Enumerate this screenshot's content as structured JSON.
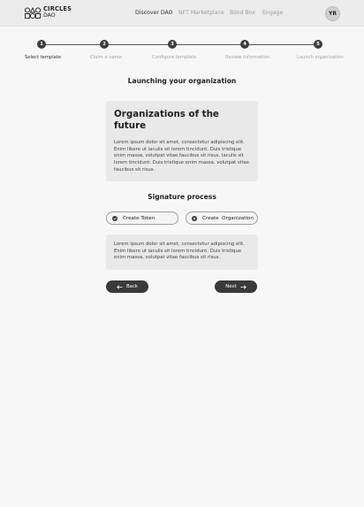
{
  "brand": {
    "line1": "CIRCLES",
    "line2": "DAO"
  },
  "nav": [
    "Discover DAO",
    "NFT Marketplace",
    "Blind Box",
    "Engage"
  ],
  "user": {
    "initials": "YR"
  },
  "steps": [
    {
      "number": "1",
      "label": "Select template",
      "active": true
    },
    {
      "number": "2",
      "label": "Claim a name",
      "active": false
    },
    {
      "number": "3",
      "label": "Configure template",
      "active": false
    },
    {
      "number": "4",
      "label": "Review information",
      "active": false
    },
    {
      "number": "5",
      "label": "Launch organization",
      "active": false
    }
  ],
  "launch": {
    "heading": "Launching your organization",
    "card_title": "Organizations of the future",
    "card_body": "Lorem ipsum dolor sit amet, consectetur adipiscing elit. Enim libero ut iaculis sit lorem tincidunt. Duis tristique enim massa, volutpat vitae faucibus sit risus. Iaculis sit lorem tincidunt. Duis tristique enim massa, volutpat vitae faucibus sit risus."
  },
  "signature": {
    "heading": "Signature process",
    "options": [
      {
        "label": "Create Token",
        "icon": "check-circle-icon"
      },
      {
        "label": "Create  Organization",
        "icon": "x-circle-icon"
      }
    ],
    "card_body": "Lorem ipsum dolor sit amet, consectetur adipiscing elit. Enim libero ut iaculis sit lorem tincidunt. Duis tristique enim massa, volutpat vitae faucibus sit risus."
  },
  "buttons": {
    "back": "Back",
    "next": "Next"
  },
  "colors": {
    "accent": "#3a3a3a",
    "header_bg": "#ececec",
    "card_bg": "#e9e9e9",
    "page_bg": "#f7f7f7"
  }
}
